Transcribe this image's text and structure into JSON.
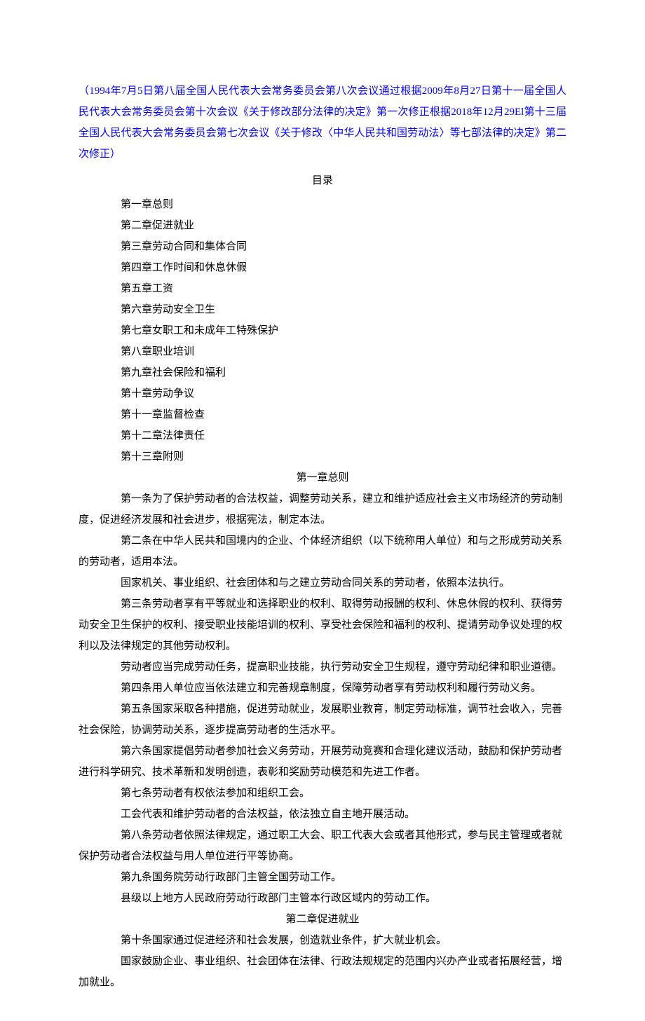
{
  "revision_note": "（1994年7月5日第八届全国人民代表大会常务委员会第八次会议通过根据2009年8月27日第十一届全国人民代表大会常务委员会第十次会议《关于修改部分法律的决定》第一次修正根据2018年12月29El第十三届全国人民代表大会常务委员会第七次会议《关于修改〈中华人民共和国劳动法〉等七部法律的决定》第二次修正）",
  "toc_title": "目录",
  "toc": [
    "第一章总则",
    "第二章促进就业",
    "第三章劳动合同和集体合同",
    "第四章工作时间和休息休假",
    "第五章工资",
    "第六章劳动安全卫生",
    "第七章女职工和未成年工特殊保护",
    "第八章职业培训",
    "第九章社会保险和福利",
    "第十章劳动争议",
    "第十一章监督检查",
    "第十二章法律责任",
    "第十三章附则"
  ],
  "chapter1": {
    "heading": "第一章总则",
    "p1a": "第一条为了保护劳动者的合法权益，调整劳动关系，建立和维护适应社会主义市场经济的劳动制",
    "p1b": "度，促进经济发展和社会进步，根据宪法，制定本法。",
    "p2a": "第二条在中华人民共和国境内的企业、个体经济组织（以下统称用人单位）和与之形成劳动关系",
    "p2b": "的劳动者，适用本法。",
    "p2c": "国家机关、事业组织、社会团体和与之建立劳动合同关系的劳动者，依照本法执行。",
    "p3a": "第三条劳动者享有平等就业和选择职业的权利、取得劳动报酬的权利、休息休假的权利、获得劳",
    "p3b": "动安全卫生保护的权利、接受职业技能培训的权利、享受社会保险和福利的权利、提请劳动争议处理的权",
    "p3c": "利以及法律规定的其他劳动权利。",
    "p3d": "劳动者应当完成劳动任务，提高职业技能，执行劳动安全卫生规程，遵守劳动纪律和职业道德。",
    "p4": "第四条用人单位应当依法建立和完善规章制度，保障劳动者享有劳动权利和履行劳动义务。",
    "p5a": "第五条国家采取各种措施，促进劳动就业，发展职业教育，制定劳动标准，调节社会收入，完善",
    "p5b": "社会保险，协调劳动关系，逐步提高劳动者的生活水平。",
    "p6a": "第六条国家提倡劳动者参加社会义务劳动，开展劳动竞赛和合理化建议活动，鼓励和保护劳动者",
    "p6b": "进行科学研究、技术革新和发明创造，表彰和奖励劳动模范和先进工作者。",
    "p7a": "第七条劳动者有权依法参加和组织工会。",
    "p7b": "工会代表和维护劳动者的合法权益，依法独立自主地开展活动。",
    "p8a": "第八条劳动者依照法律规定，通过职工大会、职工代表大会或者其他形式，参与民主管理或者就",
    "p8b": "保护劳动者合法权益与用人单位进行平等协商。",
    "p9a": "第九条国务院劳动行政部门主管全国劳动工作。",
    "p9b": "县级以上地方人民政府劳动行政部门主管本行政区域内的劳动工作。"
  },
  "chapter2": {
    "heading": "第二章促进就业",
    "p10a": "第十条国家通过促进经济和社会发展，创造就业条件，扩大就业机会。",
    "p10b": "国家鼓励企业、事业组织、社会团体在法律、行政法规规定的范围内兴办产业或者拓展经营，增",
    "p10c": "加就业。"
  }
}
